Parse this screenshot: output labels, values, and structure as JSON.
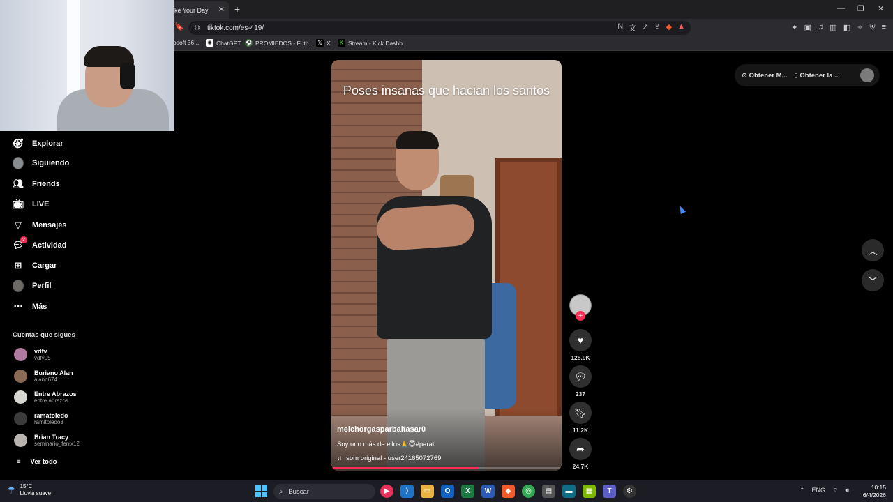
{
  "browser": {
    "tab_title": "ke Your Day",
    "url": "tiktok.com/es-419/",
    "bookmarks": [
      {
        "label": "osoft 36..."
      },
      {
        "label": "ChatGPT"
      },
      {
        "label": "PROMIEDOS - Futb..."
      },
      {
        "label": "X"
      },
      {
        "label": "Stream - Kick Dashb..."
      }
    ]
  },
  "sidebar": {
    "nav": [
      {
        "label": "Explorar",
        "icon": "compass-icon"
      },
      {
        "label": "Siguiendo",
        "icon": "avatar"
      },
      {
        "label": "Friends",
        "icon": "friends-icon"
      },
      {
        "label": "LIVE",
        "icon": "live-icon"
      },
      {
        "label": "Mensajes",
        "icon": "send-icon"
      },
      {
        "label": "Actividad",
        "icon": "inbox-icon",
        "badge": "2"
      },
      {
        "label": "Cargar",
        "icon": "plus-square-icon"
      },
      {
        "label": "Perfil",
        "icon": "avatar"
      },
      {
        "label": "Más",
        "icon": "more-icon"
      }
    ],
    "following_title": "Cuentas que sigues",
    "accounts": [
      {
        "name": "vdfv",
        "handle": "vdfv05"
      },
      {
        "name": "Buriano Alan",
        "handle": "alann674"
      },
      {
        "name": "Entre Abrazos",
        "handle": "entre.abrazos"
      },
      {
        "name": "ramatoledo",
        "handle": "ramitoledo3"
      },
      {
        "name": "Brian Tracy",
        "handle": "seminario_fenix12"
      }
    ],
    "see_all": "Ver todo"
  },
  "video": {
    "caption": "Poses insanas que hacian los santos",
    "username": "melchorgasparbaltasar0",
    "description": "Soy uno más de ellos🙏😇#parati",
    "sound": "som original - user24165072769",
    "progress": 0.64
  },
  "actions": {
    "likes": "128.9K",
    "comments": "237",
    "saves": "11.2K",
    "shares": "24.7K"
  },
  "topright": {
    "get_coins": "Obtener M...",
    "get_app": "Obtener la ..."
  },
  "taskbar": {
    "temperature": "15°C",
    "weather": "Lluvia suave",
    "search_placeholder": "Buscar",
    "language": "ENG",
    "time": "10:15",
    "date": "6/4/2026"
  },
  "colors": {
    "accent": "#fe2c55",
    "background": "#000000"
  }
}
